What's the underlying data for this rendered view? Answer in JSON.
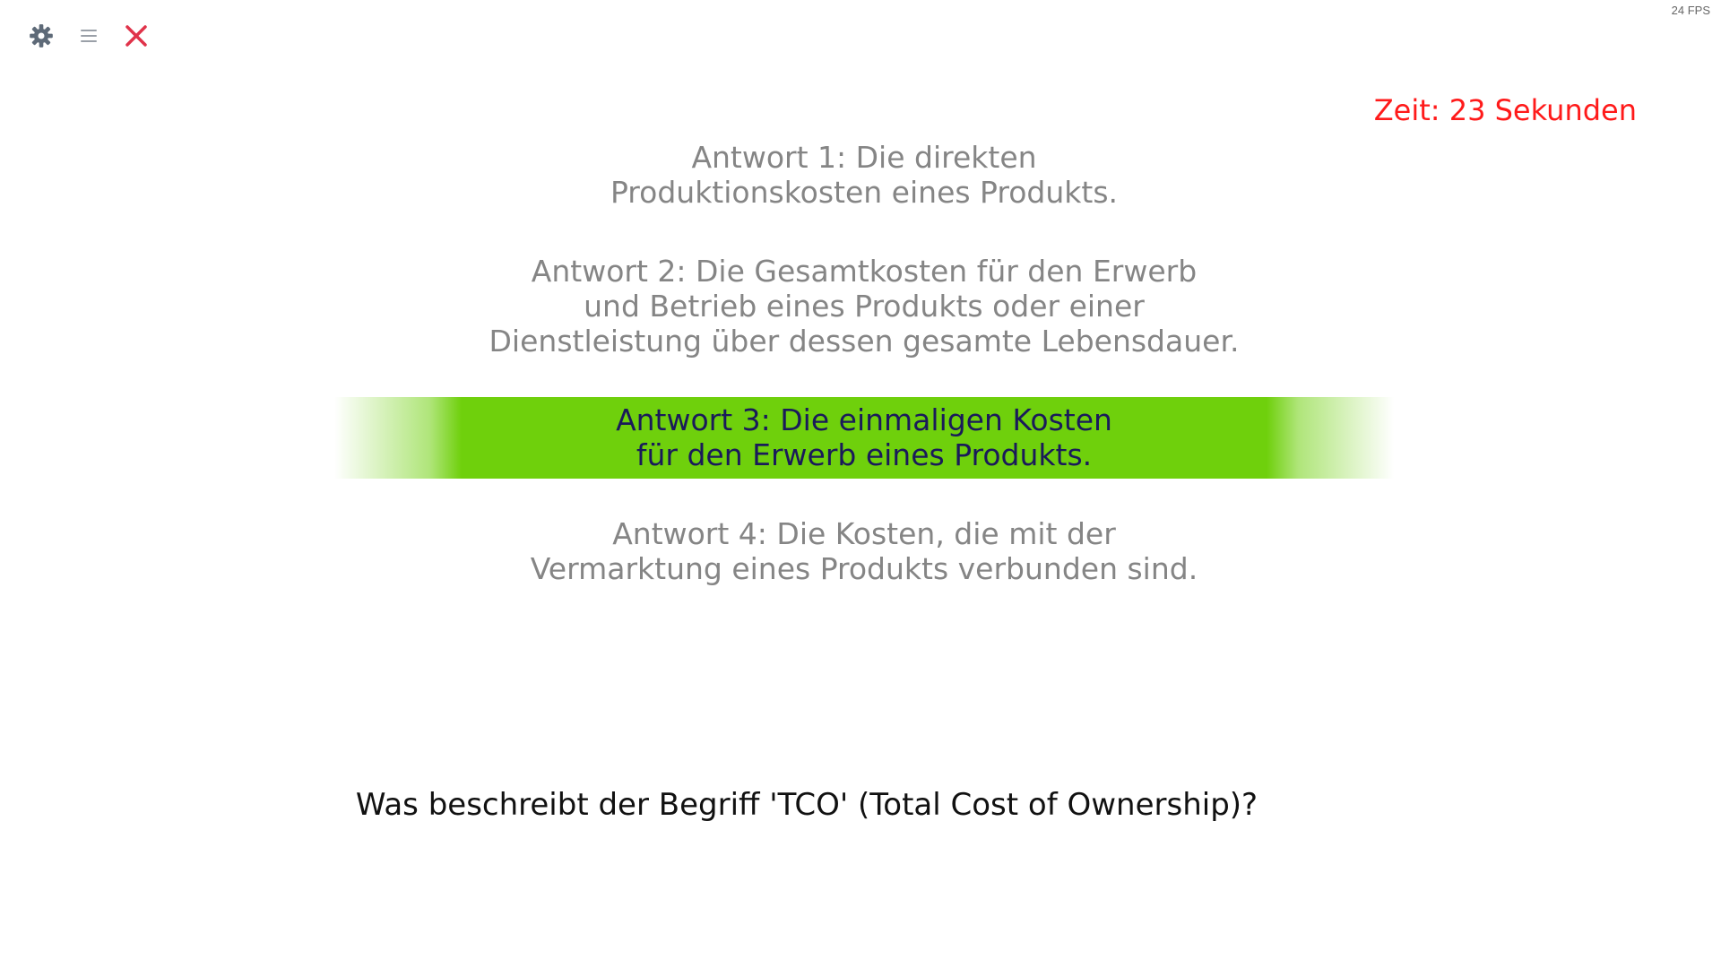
{
  "status": {
    "fps": "24 FPS"
  },
  "toolbar": {
    "icons": [
      "gear-icon",
      "menu-icon",
      "close-icon"
    ],
    "colors": {
      "gear": "#5e6a78",
      "menu": "#9aa0a8",
      "close": "#e0334a"
    }
  },
  "timer": {
    "text": "Zeit: 23 Sekunden",
    "color": "#ff1a1a"
  },
  "answers": [
    {
      "lines": [
        "Antwort 1: Die direkten",
        "Produktionskosten eines Produkts."
      ],
      "selected": false
    },
    {
      "lines": [
        "Antwort 2: Die Gesamtkosten für den Erwerb",
        "und Betrieb eines Produkts oder einer",
        "Dienstleistung über dessen gesamte Lebensdauer."
      ],
      "selected": false
    },
    {
      "lines": [
        "Antwort 3: Die einmaligen Kosten",
        "für den Erwerb eines Produkts."
      ],
      "selected": true
    },
    {
      "lines": [
        "Antwort 4: Die Kosten, die mit der",
        "Vermarktung eines Produkts verbunden sind."
      ],
      "selected": false
    }
  ],
  "highlight": {
    "color": "#6fd00c"
  },
  "question": {
    "text": "Was beschreibt der Begriff 'TCO' (Total Cost of Ownership)?"
  }
}
